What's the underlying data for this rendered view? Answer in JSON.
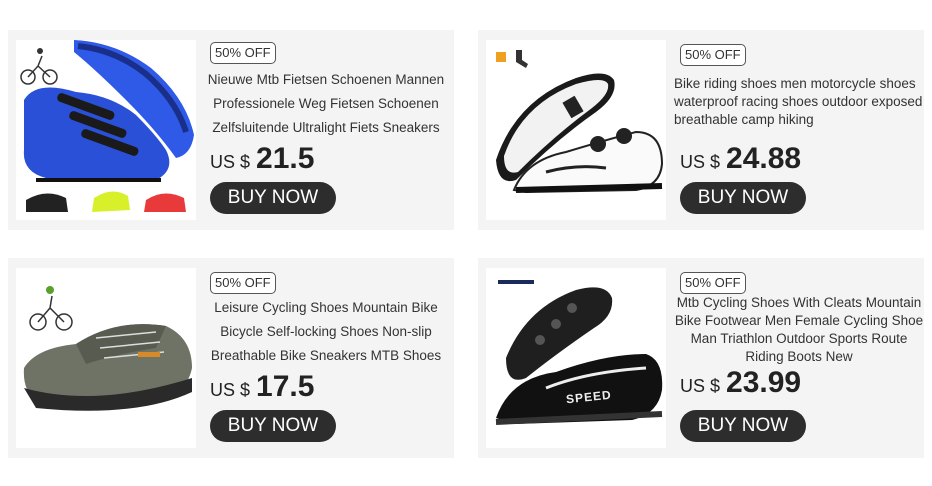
{
  "products": [
    {
      "badge": "50% OFF",
      "title": "Nieuwe Mtb Fietsen Schoenen Mannen Professionele Weg Fietsen Schoenen Zelfsluitende Ultralight Fiets Sneakers",
      "currency": "US $",
      "price": "21.5",
      "button": "BUY NOW",
      "image_icon": "blue-cycling-shoe-image"
    },
    {
      "badge": "50% OFF",
      "title": "Bike riding shoes men motorcycle shoes waterproof racing shoes outdoor exposed breathable camp hiking",
      "currency": "US $",
      "price": "24.88",
      "button": "BUY NOW",
      "image_icon": "white-road-cycling-shoe-image"
    },
    {
      "badge": "50% OFF",
      "title": "Leisure Cycling Shoes Mountain Bike Bicycle Self-locking Shoes Non-slip Breathable Bike Sneakers MTB Shoes",
      "currency": "US $",
      "price": "17.5",
      "button": "BUY NOW",
      "image_icon": "grey-mesh-cycling-shoe-image"
    },
    {
      "badge": "50% OFF",
      "title": "Mtb Cycling Shoes With Cleats Mountain Bike Footwear Men Female Cycling Shoe Man Triathlon Outdoor Sports Route Riding Boots New",
      "currency": "US $",
      "price": "23.99",
      "button": "BUY NOW",
      "image_icon": "black-speed-cycling-shoe-image",
      "brand_text": "SPEED"
    }
  ],
  "colors": {
    "card_bg": "#f4f4f4",
    "button_bg": "#2d2d2d",
    "blue_shoe": "#2a50d8",
    "yellow_shoe": "#d8f02a",
    "red_shoe": "#e83a3a"
  }
}
